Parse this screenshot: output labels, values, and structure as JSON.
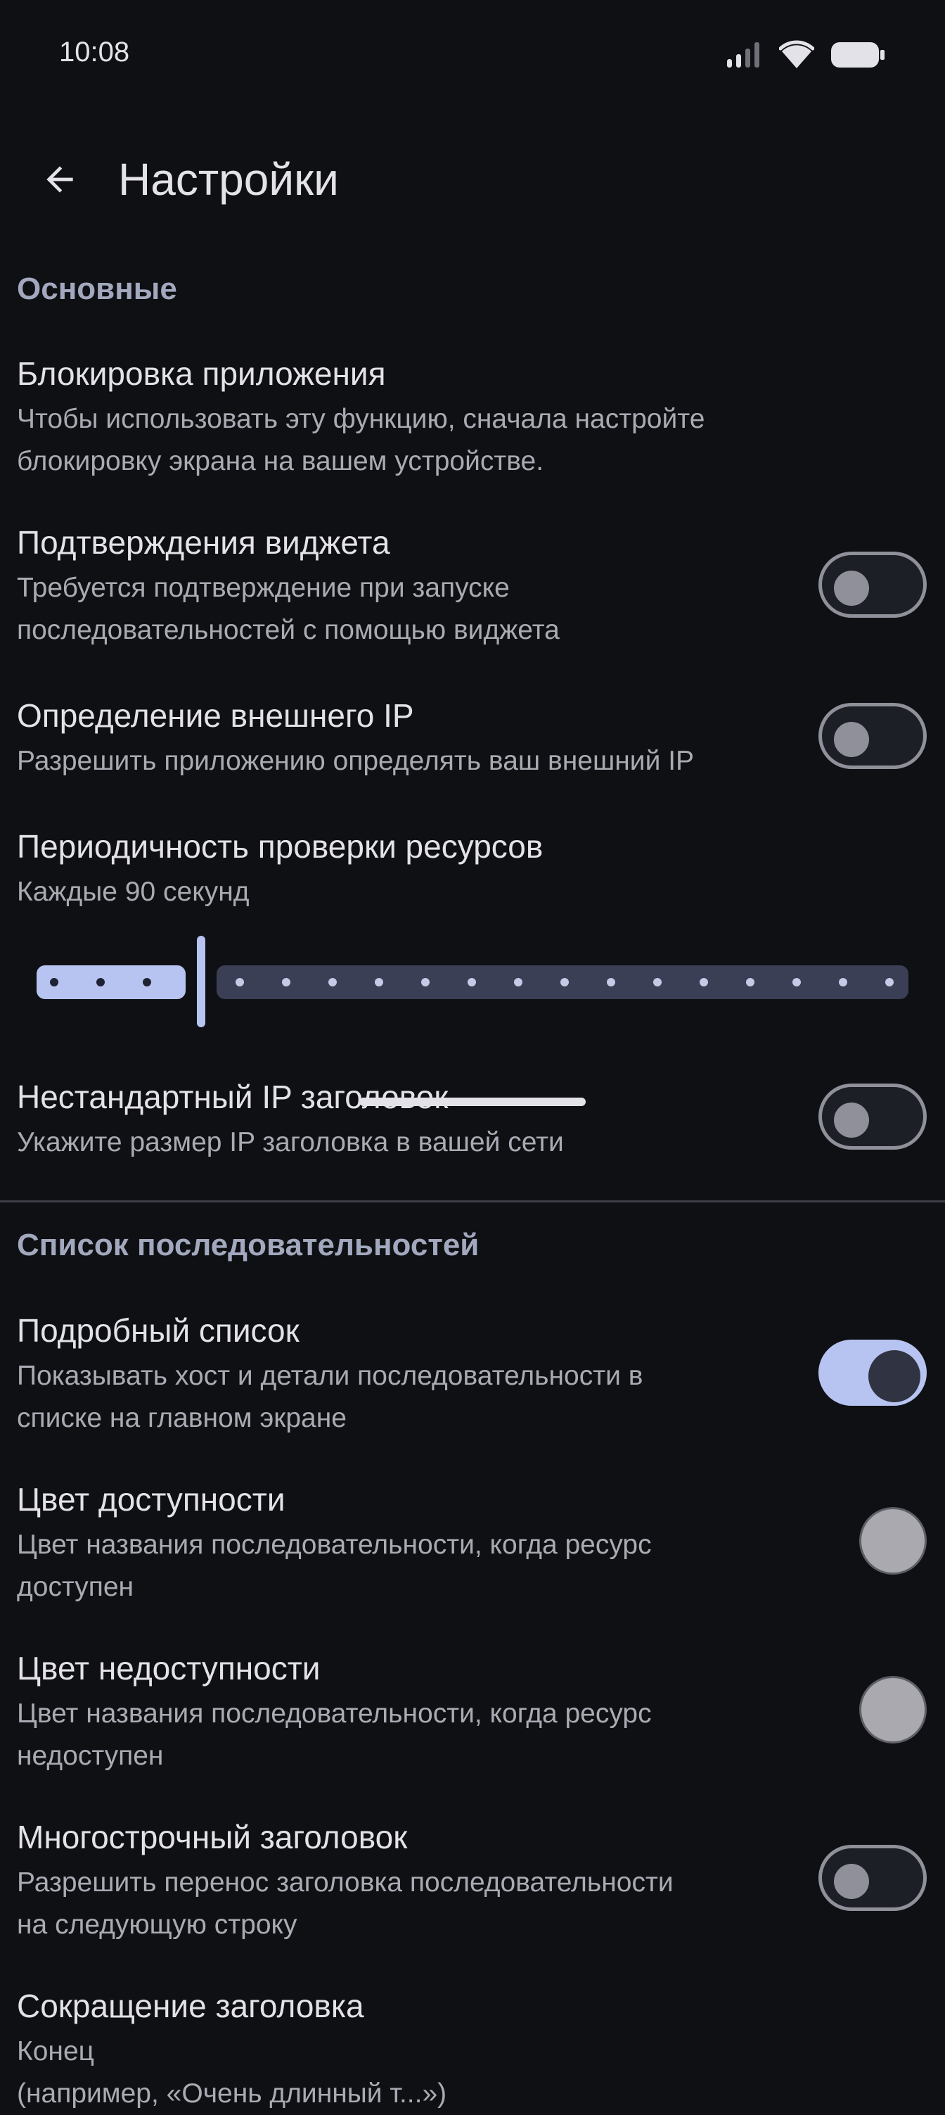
{
  "status_bar": {
    "time": "10:08"
  },
  "header": {
    "title": "Настройки"
  },
  "sections": {
    "main": "Основные",
    "sequence_list": "Список последовательностей"
  },
  "settings": {
    "app_lock": {
      "title": "Блокировка приложения",
      "subtitle_line1": "Чтобы использовать эту функцию, сначала настройте",
      "subtitle_line2": "блокировку экрана на вашем устройстве."
    },
    "widget_confirm": {
      "title": "Подтверждения виджета",
      "subtitle_line1": "Требуется подтверждение при запуске",
      "subtitle_line2": "последовательностей с помощью виджета",
      "enabled": false
    },
    "external_ip": {
      "title": "Определение внешнего IP",
      "subtitle_line1": "Разрешить приложению определять ваш внешний IP",
      "enabled": false
    },
    "check_interval": {
      "title": "Периодичность проверки ресурсов",
      "subtitle_line1": "Каждые 90 секунд",
      "slider_step": 4,
      "slider_steps_total": 19
    },
    "custom_ip_header": {
      "title": "Нестандартный IP заголовок",
      "subtitle_line1": "Укажите размер IP заголовка в вашей сети",
      "enabled": false
    },
    "detailed_list": {
      "title": "Подробный список",
      "subtitle_line1": "Показывать хост и детали последовательности в",
      "subtitle_line2": "списке на главном экране",
      "enabled": true
    },
    "available_color": {
      "title": "Цвет доступности",
      "subtitle_line1": "Цвет названия последовательности, когда ресурс",
      "subtitle_line2": "доступен",
      "color": "#aaa9b0"
    },
    "unavailable_color": {
      "title": "Цвет недоступности",
      "subtitle_line1": "Цвет названия последовательности, когда ресурс",
      "subtitle_line2": "недоступен",
      "color": "#aaa9b0"
    },
    "multiline_header": {
      "title": "Многострочный заголовок",
      "subtitle_line1": "Разрешить перенос заголовка последовательности",
      "subtitle_line2": "на следующую строку",
      "enabled": false
    },
    "header_truncation": {
      "title": "Сокращение заголовка",
      "subtitle_line1": "Конец",
      "subtitle_line2": "(например, «Очень длинный т...»)"
    }
  },
  "colors": {
    "background": "#0f1014",
    "accent": "#b7c4f1",
    "section_header": "#a2a8bd",
    "slider_inactive": "#3a3f55"
  }
}
